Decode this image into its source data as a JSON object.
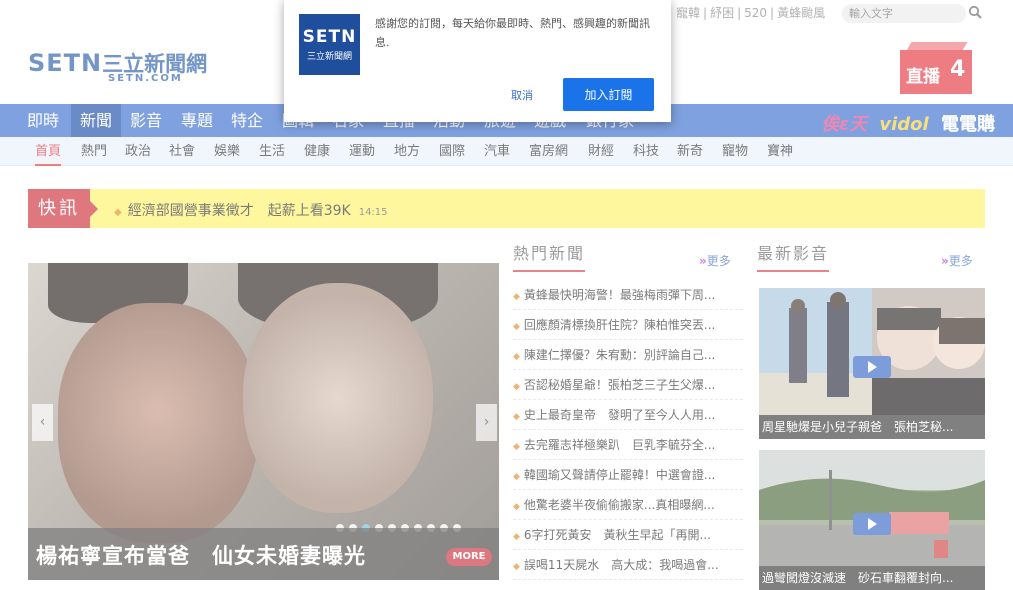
{
  "topbar": {
    "links": [
      "寵韓",
      "紓困",
      "520",
      "黃蜂颱風"
    ],
    "search_placeholder": "輸入文字"
  },
  "logo": {
    "main": "SETN",
    "cn": "三立新聞網",
    "sub": "SETN.COM"
  },
  "live": {
    "label": "直播",
    "count": "4"
  },
  "nav_main": [
    "即時",
    "新聞",
    "影音",
    "專題",
    "特企",
    "圖輯",
    "名家",
    "直播",
    "活動",
    "旅遊",
    "遊戲",
    "銀行家"
  ],
  "nav_main_active": "新聞",
  "brands": {
    "b1": "俟ε天",
    "b2": "vidol",
    "b3": "電電購"
  },
  "nav_sub": [
    "首頁",
    "熱門",
    "政治",
    "社會",
    "娛樂",
    "生活",
    "健康",
    "運動",
    "地方",
    "國際",
    "汽車",
    "富房網",
    "財經",
    "科技",
    "新奇",
    "寵物",
    "寶神"
  ],
  "flash": {
    "label": "快訊",
    "text": "經濟部國營事業徵才　起薪上看39K",
    "time": "14:15"
  },
  "slider": {
    "caption": "楊祐寧宣布當爸　仙女未婚妻曝光",
    "more": "MORE",
    "prev": "‹",
    "next": "›",
    "dots": 10,
    "active_dot": 3
  },
  "hot_news": {
    "title": "熱門新聞",
    "more": "更多",
    "items": [
      "黃蜂最快明海警！最強梅雨彈下周...",
      "回應顏清標換肝住院？陳柏惟突丟...",
      "陳建仁擇優？朱宥勳：別評論自己...",
      "否認秘婚星爺！張柏芝三子生父爆...",
      "史上最奇皇帝　發明了至今人人用...",
      "去完羅志祥極樂趴　巨乳李毓芬全...",
      "韓國瑜又聲請停止罷韓！中選會證...",
      "他驚老婆半夜偷偷搬家...真相曝網...",
      "6字打死黃安　黃秋生早起「再開...",
      "誤喝11天屍水　高大成：我喝過會..."
    ]
  },
  "latest_video": {
    "title": "最新影音",
    "more": "更多",
    "items": [
      {
        "caption": "周星馳爆是小兒子親爸　張柏芝秘..."
      },
      {
        "caption": "過彎闖燈沒減速　砂石車翻覆封向..."
      }
    ]
  },
  "popup": {
    "logo_main": "SETN",
    "logo_sub": "三立新聞網",
    "message": "感謝您的訂閱，每天給你最即時、熱門、感興趣的新聞訊息.",
    "cancel": "取消",
    "ok": "加入訂閱"
  }
}
